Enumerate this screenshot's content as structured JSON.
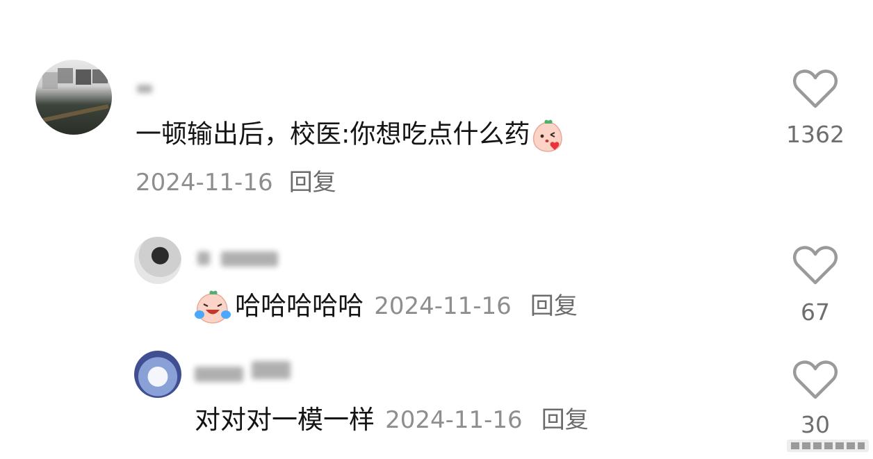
{
  "comments": [
    {
      "text": "一顿输出后，校医:你想吃点什么药",
      "date": "2024-11-16",
      "reply_label": "回复",
      "likes": "1362"
    },
    {
      "text": "哈哈哈哈哈",
      "date": "2024-11-16",
      "reply_label": "回复",
      "likes": "67"
    },
    {
      "text": "对对对一模一样",
      "date": "2024-11-16",
      "reply_label": "回复",
      "likes": "30"
    }
  ],
  "icons": {
    "like": "heart-outline-icon",
    "emoji1": "peach-kiss-emoji",
    "emoji2": "peach-laugh-cry-emoji"
  }
}
